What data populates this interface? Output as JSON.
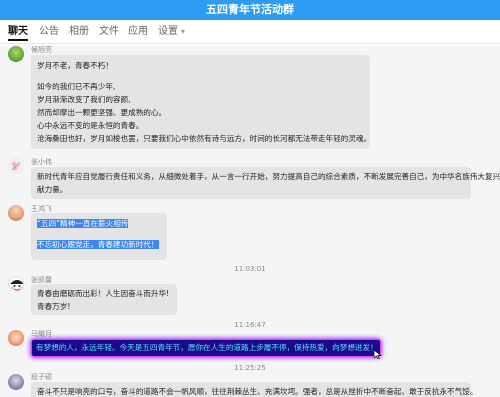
{
  "window": {
    "title": "五四青年节活动群"
  },
  "tabs": [
    {
      "label": "聊天",
      "active": true
    },
    {
      "label": "公告"
    },
    {
      "label": "相册"
    },
    {
      "label": "文件"
    },
    {
      "label": "应用"
    },
    {
      "label": "设置",
      "has_dropdown": true
    }
  ],
  "messages": [
    {
      "sender": "候旭亮",
      "lines": [
        "岁月不老，青春不朽！",
        "",
        "如今的我们已不再少年,",
        "岁月渐渐改变了我们的容颜,",
        "然而却摩出一颗更坚强、更成熟的心。",
        "心中永远不变的是永恒的青春。",
        "沧海桑田也好，岁月如梭也罢，只要我们心中依然有诗与远方，时间的长河都无法带走年轻的灵魂。"
      ]
    },
    {
      "sender": "张小伟",
      "lines": [
        "新时代青年应自觉履行责任和义务，从细微处着手，从一言一行开始，努力提高自己的综合素质，不断发展完善自己，为中华名族伟大复兴贡",
        "献力量。"
      ]
    },
    {
      "sender": "王鸿飞",
      "lines": [
        "“五四”精神一直在薪火相传",
        "",
        "不忘初心跟党走，青春建功新时代！"
      ]
    },
    {
      "timestamp": "11:03:01"
    },
    {
      "sender": "张凯馨",
      "lines": [
        "青春由磨砺而出彩！人生因奋斗而升华!",
        "青春万岁!"
      ]
    },
    {
      "timestamp": "11:16:47"
    },
    {
      "sender": "马耀月",
      "lines": [
        "有梦想的人，永远年轻。今天是五四青年节，愿你在人生的道路上步履不停，保持热爱，向梦想进发！"
      ]
    },
    {
      "timestamp": "11:25:25"
    },
    {
      "sender": "段子硕",
      "lines": [
        "奋斗不只是响亮的口号，奋斗的道路不会一帆风顺，往往荆棘丛生、充满坎坷。强者，总是从挫折中不断奋起、敢于反抗永不气馁。"
      ]
    }
  ],
  "colors": {
    "titlebar": "#2f9cf3",
    "selection": "#3b86f2",
    "highlight_bg": "#1a0a8c",
    "highlight_border": "#e040fb",
    "highlight_text": "#5ce1ff"
  }
}
